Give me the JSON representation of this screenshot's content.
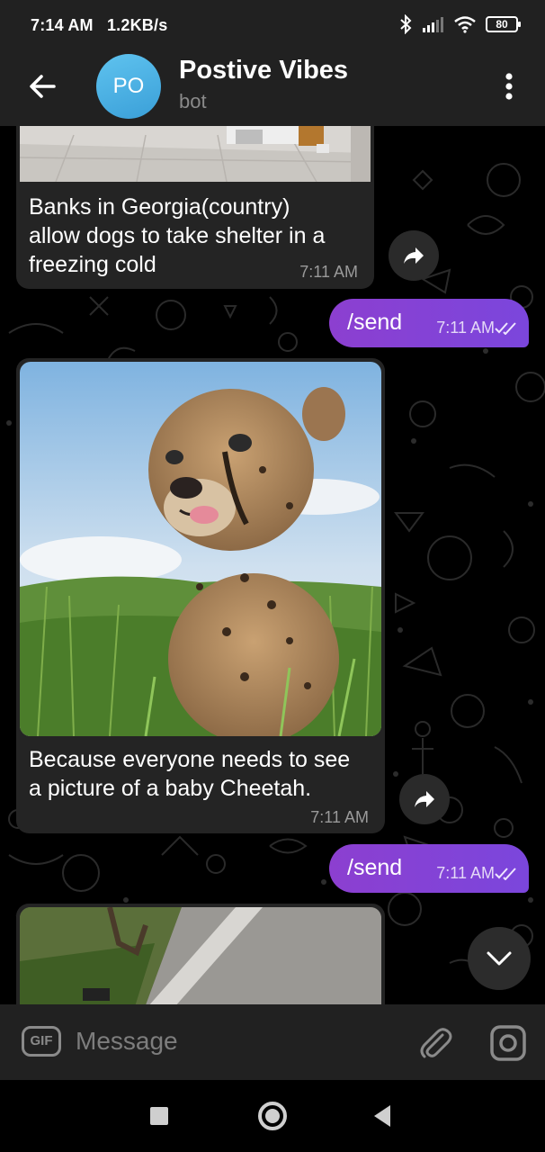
{
  "status_bar": {
    "time": "7:14 AM",
    "speed": "1.2KB/s",
    "battery": "80"
  },
  "header": {
    "avatar_initials": "PO",
    "title": "Postive Vibes",
    "subtitle": "bot",
    "avatar_color": "#48b0e3"
  },
  "messages": [
    {
      "type": "incoming",
      "caption_lines": [
        "Banks in Georgia(country)",
        "allow dogs to take shelter in a",
        "freezing cold"
      ],
      "time": "7:11 AM"
    },
    {
      "type": "outgoing",
      "text": "/send",
      "time": "7:11 AM"
    },
    {
      "type": "incoming",
      "caption_lines": [
        "Because everyone needs to see",
        "a picture of a baby Cheetah."
      ],
      "time": "7:11 AM"
    },
    {
      "type": "outgoing",
      "text": "/send",
      "time": "7:11 AM"
    }
  ],
  "input": {
    "gif_label": "GIF",
    "placeholder": "Message"
  },
  "icons": {
    "back": "arrow-left-icon",
    "menu": "kebab-menu-icon",
    "share": "forward-arrow-icon",
    "scroll": "chevron-down-icon",
    "attach": "paperclip-icon",
    "camera": "camera-icon",
    "ticks": "double-check-icon"
  },
  "colors": {
    "outgoing_bubble": "#7b46dc",
    "incoming_bubble": "#242424",
    "bar": "#212121"
  }
}
